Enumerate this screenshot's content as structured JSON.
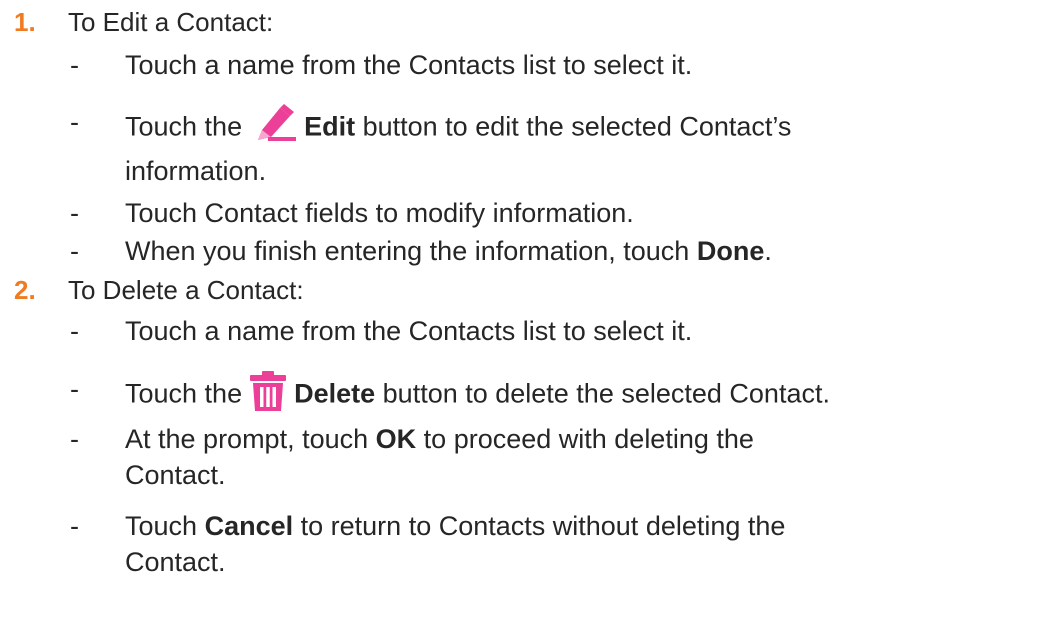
{
  "colors": {
    "number": "#f07b22",
    "icon": "#ec3f97",
    "text": "#262626"
  },
  "sections": [
    {
      "number": "1.",
      "title": "To Edit a Contact:",
      "bullets": [
        {
          "dash": "-",
          "text": "Touch a name from the Contacts list to select it."
        },
        {
          "dash": "-",
          "pre": "Touch the",
          "icon": "pencil-icon",
          "bold": "Edit",
          "post": "button to edit the selected Contact’s",
          "cont": "information."
        },
        {
          "dash": "-",
          "text": "Touch Contact fields to modify information."
        },
        {
          "dash": "-",
          "pre": "When you finish entering the information, touch",
          "bold": "Done",
          "post": "."
        }
      ]
    },
    {
      "number": "2.",
      "title": "To Delete a Contact:",
      "bullets": [
        {
          "dash": "-",
          "text": "Touch a name from the Contacts list to select it."
        },
        {
          "dash": "-",
          "pre": "Touch the",
          "icon": "trash-icon",
          "bold": "Delete",
          "post": "button to delete the selected Contact."
        },
        {
          "dash": "-",
          "pre": "At the prompt, touch",
          "bold": "OK",
          "post": "to proceed with deleting the",
          "cont": "Contact."
        },
        {
          "dash": "-",
          "pre": "Touch",
          "bold": "Cancel",
          "post": "to return to Contacts without deleting the",
          "cont": "Contact."
        }
      ]
    }
  ]
}
